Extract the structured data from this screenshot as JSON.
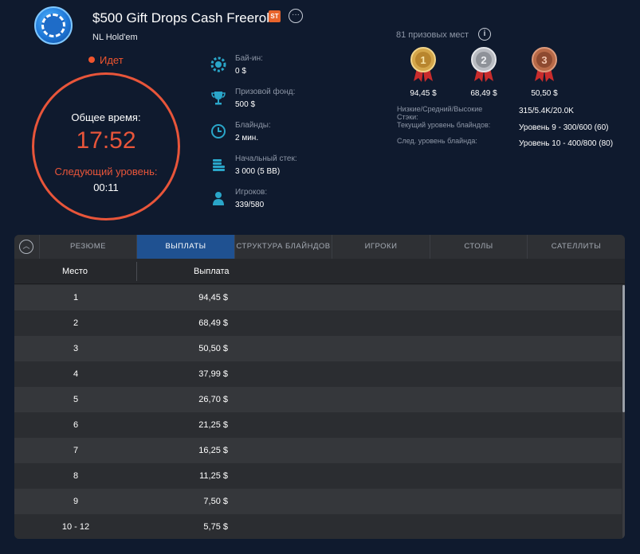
{
  "header": {
    "title": "$500 Gift Drops Cash Freeroll",
    "badge": "ST",
    "more_icon": "ellipsis-icon",
    "subtitle": "NL Hold'em",
    "status": "Идет"
  },
  "timer": {
    "total_label": "Общее время:",
    "total_value": "17:52",
    "next_label": "Следующий уровень:",
    "next_value": "00:11"
  },
  "info": [
    {
      "icon": "chip-icon",
      "label": "Бай-ин:",
      "value": "0 $"
    },
    {
      "icon": "trophy-icon",
      "label": "Призовой фонд:",
      "value": "500 $"
    },
    {
      "icon": "clock-icon",
      "label": "Блайнды:",
      "value": "2 мин."
    },
    {
      "icon": "chip-stack-icon",
      "label": "Начальный стек:",
      "value": "3 000 (5 BB)"
    },
    {
      "icon": "user-icon",
      "label": "Игроков:",
      "value": "339/580"
    }
  ],
  "prizes": {
    "count_label": "81 призовых мест",
    "medals": [
      {
        "place": "1",
        "amount": "94,45 $",
        "color": "#d4a64a"
      },
      {
        "place": "2",
        "amount": "68,49 $",
        "color": "#b9bcc2"
      },
      {
        "place": "3",
        "amount": "50,50 $",
        "color": "#b86a48"
      }
    ]
  },
  "stats": [
    {
      "label": "Низкие/Средний/Высокие Стэки:",
      "value": "315/5.4K/20.0K"
    },
    {
      "label": "Текущий уровень блайндов:",
      "value": "Уровень 9 - 300/600 (60)"
    },
    {
      "label": "След. уровень блайнда:",
      "value": "Уровень 10 - 400/800 (80)"
    }
  ],
  "tabs": [
    {
      "label": "РЕЗЮМЕ",
      "active": false
    },
    {
      "label": "ВЫПЛАТЫ",
      "active": true
    },
    {
      "label": "СТРУКТУРА БЛАЙНДОВ",
      "active": false
    },
    {
      "label": "ИГРОКИ",
      "active": false
    },
    {
      "label": "СТОЛЫ",
      "active": false
    },
    {
      "label": "САТЕЛЛИТЫ",
      "active": false
    }
  ],
  "table": {
    "columns": [
      "Место",
      "Выплата"
    ],
    "rows": [
      [
        "1",
        "94,45 $"
      ],
      [
        "2",
        "68,49 $"
      ],
      [
        "3",
        "50,50 $"
      ],
      [
        "4",
        "37,99 $"
      ],
      [
        "5",
        "26,70 $"
      ],
      [
        "6",
        "21,25 $"
      ],
      [
        "7",
        "16,25 $"
      ],
      [
        "8",
        "11,25 $"
      ],
      [
        "9",
        "7,50 $"
      ],
      [
        "10 - 12",
        "5,75 $"
      ]
    ]
  },
  "colors": {
    "accent": "#e8553a",
    "active_tab": "#1f5191",
    "background": "#0f1a2e"
  }
}
